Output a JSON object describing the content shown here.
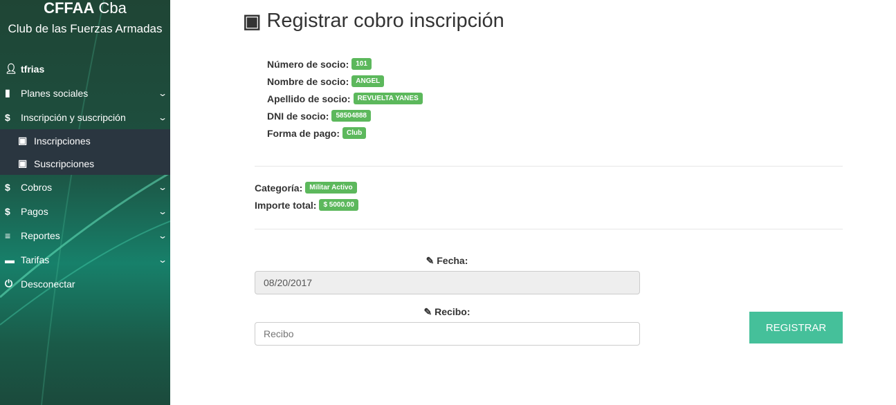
{
  "sidebar": {
    "brand_bold": "CFFAA",
    "brand_rest": "Cba",
    "subtitle": "Club de las Fuerzas Armadas",
    "user": "tfrias",
    "items": [
      {
        "label": "Planes sociales",
        "icon": "file-icon"
      },
      {
        "label": "Inscripción y suscripción",
        "icon": "dollar-icon"
      },
      {
        "label": "Cobros",
        "icon": "dollar-icon"
      },
      {
        "label": "Pagos",
        "icon": "dollar-icon"
      },
      {
        "label": "Reportes",
        "icon": "chart-icon"
      },
      {
        "label": "Tarifas",
        "icon": "credit-card-icon"
      },
      {
        "label": "Desconectar",
        "icon": "power-icon"
      }
    ],
    "subitems": [
      {
        "label": "Inscripciones"
      },
      {
        "label": "Suscripciones"
      }
    ]
  },
  "page": {
    "title": "Registrar cobro inscripción"
  },
  "socio": {
    "numero_label": "Número de socio:",
    "numero": "101",
    "nombre_label": "Nombre de socio:",
    "nombre": "ANGEL",
    "apellido_label": "Apellido de socio:",
    "apellido": "REVUELTA YANES",
    "dni_label": "DNI de socio:",
    "dni": "58504888",
    "forma_label": "Forma de pago:",
    "forma": "Club"
  },
  "resumen": {
    "categoria_label": "Categoría:",
    "categoria": "Militar Activo",
    "importe_label": "Importe total:",
    "importe": "$ 5000.00"
  },
  "form": {
    "fecha_label": "Fecha:",
    "fecha_value": "08/20/2017",
    "recibo_label": "Recibo:",
    "recibo_placeholder": "Recibo",
    "submit": "REGISTRAR"
  },
  "colors": {
    "badge": "#5cb85c",
    "button": "#45c09a",
    "submenu": "#2a3640"
  }
}
